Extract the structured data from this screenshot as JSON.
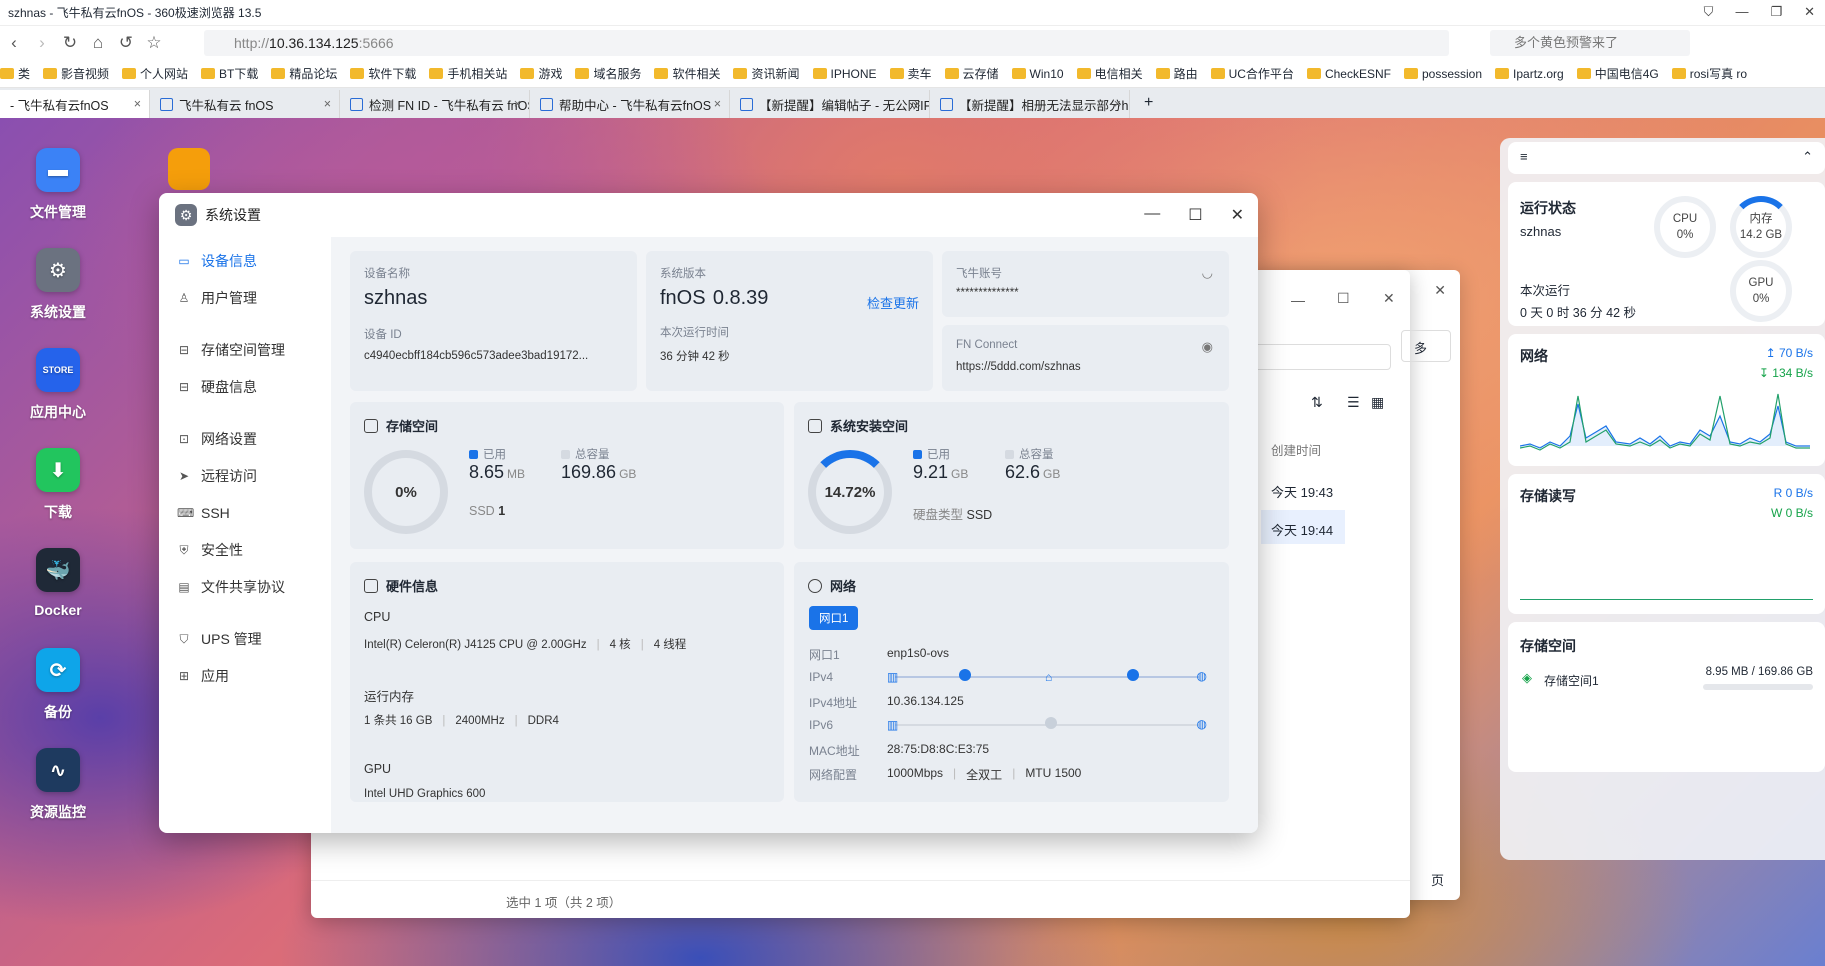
{
  "browser": {
    "title": "szhnas - 飞牛私有云fnOS - 360极速浏览器 13.5",
    "url_prefix": "http://",
    "url_host": "10.36.134.125",
    "url_port": ":5666",
    "search_placeholder": "多个黄色预警来了",
    "bookmarks": [
      "类",
      "影音视频",
      "个人网站",
      "BT下载",
      "精品论坛",
      "软件下载",
      "手机相关站",
      "游戏",
      "域名服务",
      "软件相关",
      "资讯新闻",
      "IPHONE",
      "卖车",
      "云存储",
      "Win10",
      "电信相关",
      "路由",
      "UC合作平台",
      "CheckESNF",
      "possession",
      "Ipartz.org",
      "中国电信4G",
      "rosi写真 ro"
    ],
    "tabs": [
      "- 飞牛私有云fnOS",
      "飞牛私有云 fnOS",
      "检测 FN ID - 飞牛私有云 fnOS",
      "帮助中心 - 飞牛私有云fnOS",
      "【新提醒】编辑帖子 - 无公网IP...",
      "【新提醒】相册无法显示部分he..."
    ]
  },
  "desktop": {
    "icons": [
      "文件管理",
      "系统设置",
      "应用中心",
      "下载",
      "Docker",
      "备份",
      "资源监控"
    ]
  },
  "window": {
    "title": "系统设置",
    "sidebar": [
      "设备信息",
      "用户管理",
      "存储空间管理",
      "硬盘信息",
      "网络设置",
      "远程访问",
      "SSH",
      "安全性",
      "文件共享协议",
      "UPS 管理",
      "应用"
    ],
    "device": {
      "name_label": "设备名称",
      "name": "szhnas",
      "id_label": "设备 ID",
      "id": "c4940ecbff184cb596c573adee3bad19172..."
    },
    "version": {
      "label": "系统版本",
      "os": "fnOS",
      "ver": "0.8.39",
      "check": "检查更新",
      "uptime_label": "本次运行时间",
      "uptime": "36 分钟 42 秒"
    },
    "account": {
      "label": "飞牛账号",
      "value": "**************"
    },
    "fnconnect": {
      "label": "FN Connect",
      "value": "https://5ddd.com/szhnas"
    },
    "storage": {
      "title": "存储空间",
      "percent": "0%",
      "used_label": "已用",
      "used": "8.65",
      "used_unit": "MB",
      "total_label": "总容量",
      "total": "169.86",
      "total_unit": "GB",
      "disk_type": "SSD",
      "disk_count": "1"
    },
    "sysdisk": {
      "title": "系统安装空间",
      "percent": "14.72%",
      "used_label": "已用",
      "used": "9.21",
      "used_unit": "GB",
      "total_label": "总容量",
      "total": "62.6",
      "total_unit": "GB",
      "type_label": "硬盘类型",
      "type": "SSD"
    },
    "hardware": {
      "title": "硬件信息",
      "cpu_label": "CPU",
      "cpu": "Intel(R) Celeron(R) J4125 CPU @ 2.00GHz",
      "cores": "4 核",
      "threads": "4 线程",
      "mem_label": "运行内存",
      "mem": "1 条共 16 GB",
      "mem_speed": "2400MHz",
      "mem_type": "DDR4",
      "gpu_label": "GPU",
      "gpu": "Intel UHD Graphics 600"
    },
    "network": {
      "title": "网络",
      "port_tab": "网口1",
      "rows": [
        {
          "k": "网口1",
          "v": "enp1s0-ovs"
        },
        {
          "k": "IPv4",
          "v": ""
        },
        {
          "k": "IPv4地址",
          "v": "10.36.134.125"
        },
        {
          "k": "IPv6",
          "v": ""
        },
        {
          "k": "MAC地址",
          "v": "28:75:D8:8C:E3:75"
        },
        {
          "k": "网络配置",
          "v": "1000Mbps"
        }
      ],
      "duplex": "全双工",
      "mtu": "MTU 1500"
    }
  },
  "backwindow": {
    "col": "创建时间",
    "rows": [
      "今天 19:43",
      "今天 19:44"
    ],
    "footer": "选中 1 项（共 2 项）",
    "more": "多",
    "page": "页"
  },
  "panel": {
    "status_title": "运行状态",
    "host": "szhnas",
    "cpu_label": "CPU",
    "cpu": "0%",
    "mem_label": "内存",
    "mem": "14.2 GB",
    "gpu_label": "GPU",
    "gpu": "0%",
    "run_label": "本次运行",
    "run": "0 天 0 时 36 分 42 秒",
    "net_title": "网络",
    "up": "70 B/s",
    "down": "134 B/s",
    "io_title": "存储读写",
    "read": "R  0 B/s",
    "write": "W  0 B/s",
    "st_title": "存储空间",
    "st_name": "存储空间1",
    "st_value": "8.95 MB / 169.86 GB"
  }
}
